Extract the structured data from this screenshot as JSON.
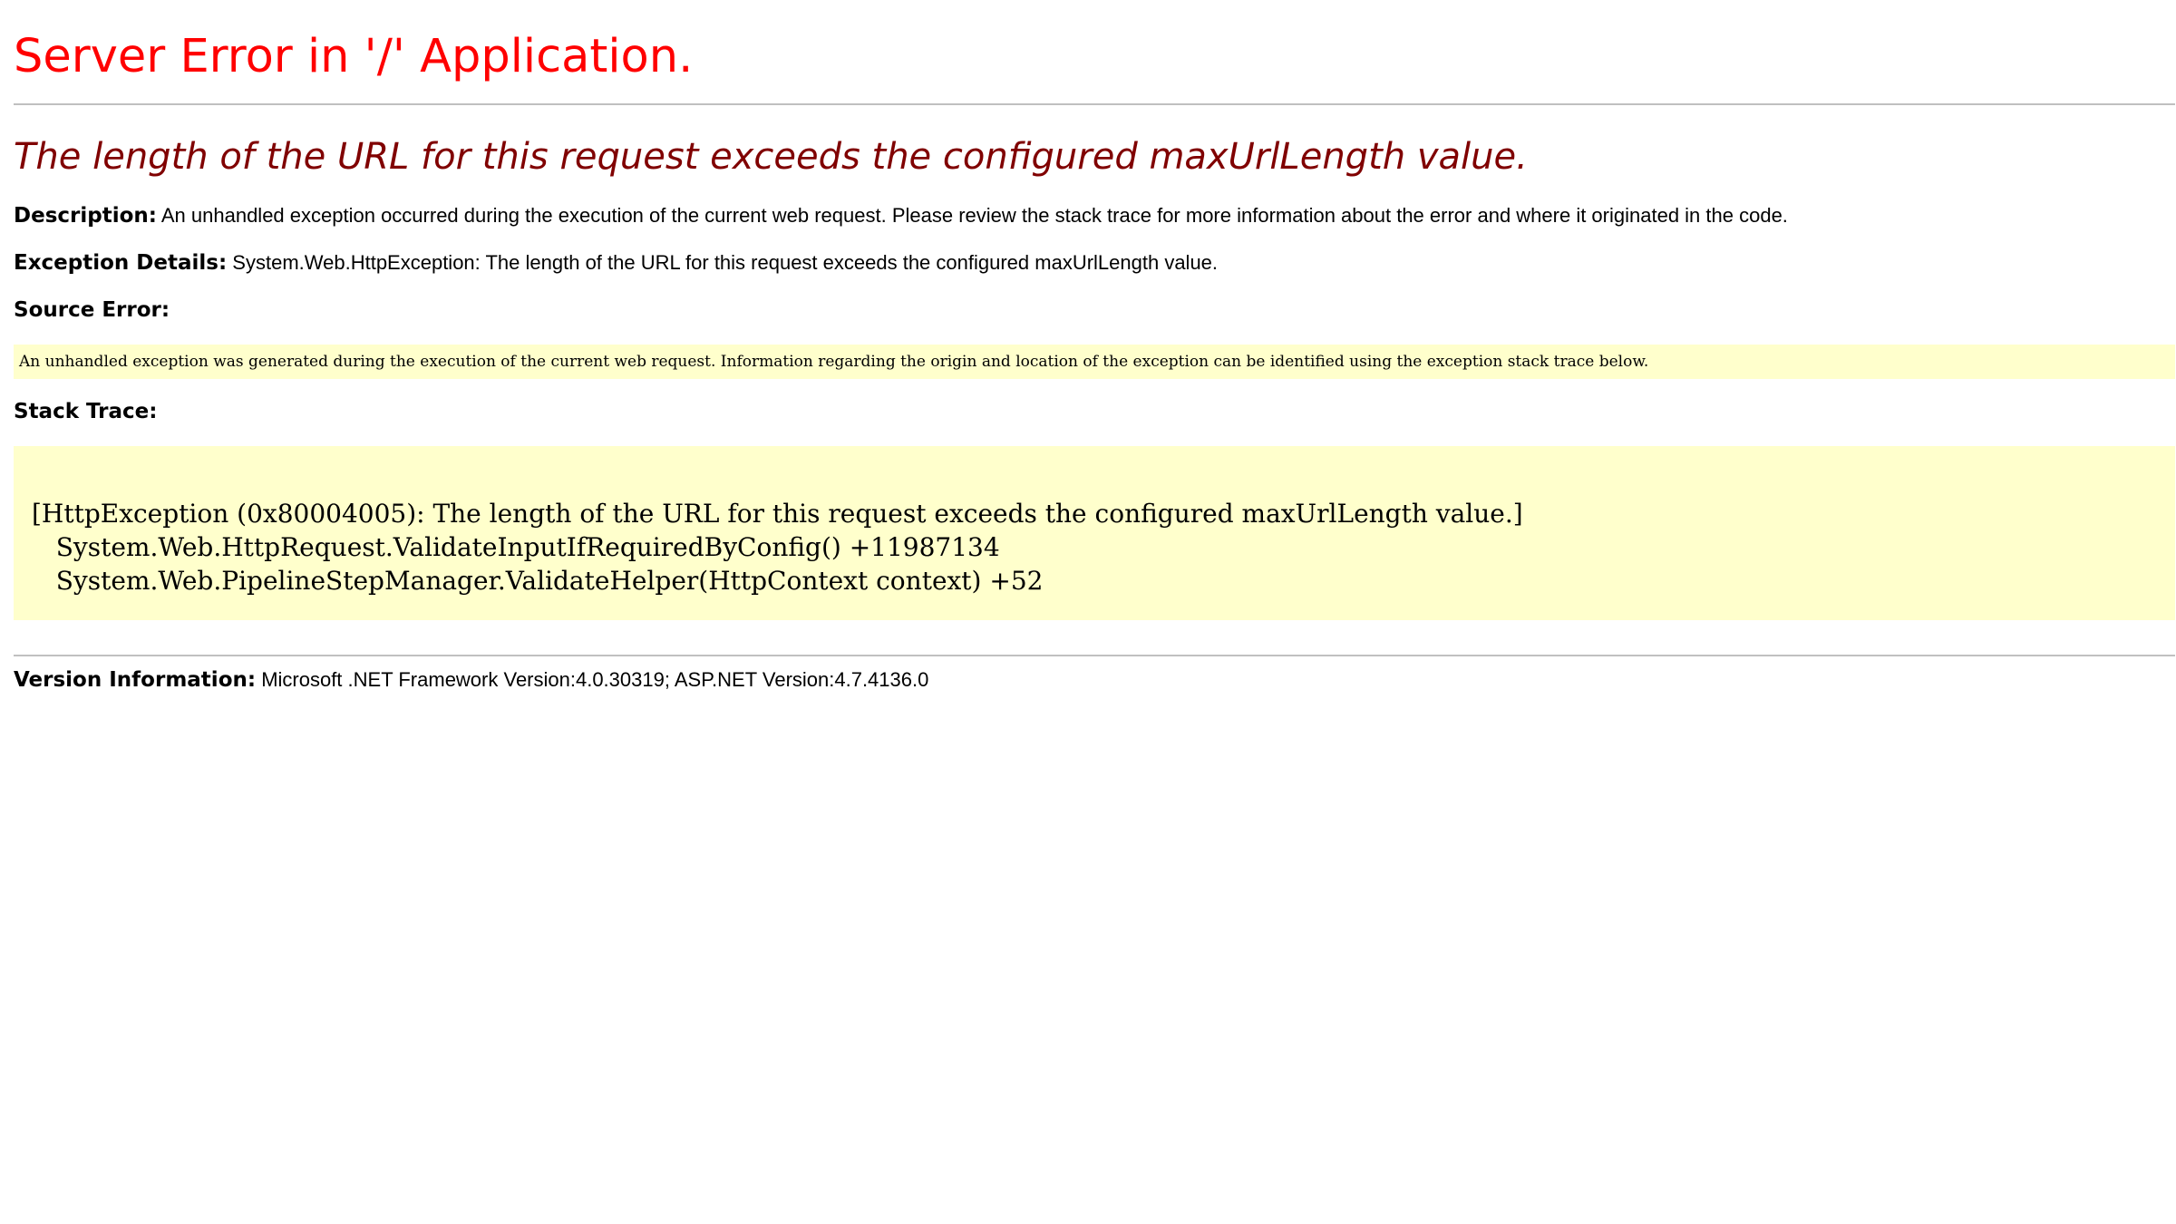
{
  "title": "Server Error in '/' Application.",
  "subtitle": "The length of the URL for this request exceeds the configured maxUrlLength value.",
  "description": {
    "label": "Description:",
    "text": "An unhandled exception occurred during the execution of the current web request. Please review the stack trace for more information about the error and where it originated in the code."
  },
  "exception_details": {
    "label": "Exception Details:",
    "text": "System.Web.HttpException: The length of the URL for this request exceeds the configured maxUrlLength value."
  },
  "source_error": {
    "label": "Source Error:",
    "text": "An unhandled exception was generated during the execution of the current web request. Information regarding the origin and location of the exception can be identified using the exception stack trace below."
  },
  "stack_trace": {
    "label": "Stack Trace:",
    "lines": [
      "[HttpException (0x80004005): The length of the URL for this request exceeds the configured maxUrlLength value.]",
      "   System.Web.HttpRequest.ValidateInputIfRequiredByConfig() +11987134",
      "   System.Web.PipelineStepManager.ValidateHelper(HttpContext context) +52"
    ]
  },
  "version_information": {
    "label": "Version Information:",
    "text": "Microsoft .NET Framework Version:4.0.30319; ASP.NET Version:4.7.4136.0"
  },
  "colors": {
    "title": "#ff0000",
    "subtitle": "#800000",
    "code_background": "#ffffcc",
    "divider": "#c0c0c0"
  }
}
